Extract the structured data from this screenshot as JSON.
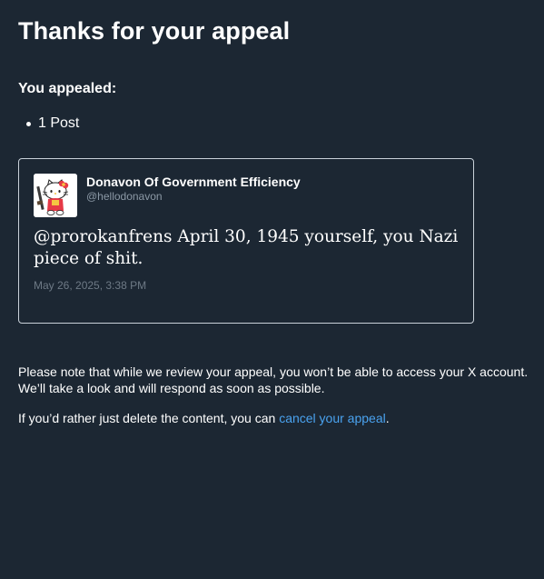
{
  "header": {
    "title": "Thanks for your appeal"
  },
  "appeal": {
    "heading": "You appealed:",
    "items": [
      "1 Post"
    ]
  },
  "post": {
    "author_name": "Donavon Of Government Efficiency",
    "author_handle": "@hellodonavon",
    "avatar_icon": "hello-kitty-avatar",
    "text": "@prorokanfrens April 30, 1945 yourself, you Nazi piece of shit.",
    "timestamp": "May 26, 2025, 3:38 PM"
  },
  "notice": {
    "line1": "Please note that while we review your appeal, you won’t be able to access your X account. We’ll take a look and will respond as soon as possible.",
    "line2_prefix": "If you’d rather just delete the content, you can ",
    "cancel_link_label": "cancel your appeal",
    "line2_suffix": "."
  },
  "colors": {
    "background": "#1c2733",
    "link": "#4aa3f0",
    "muted_text": "#8b98a5",
    "card_border": "#c9d1d9"
  }
}
